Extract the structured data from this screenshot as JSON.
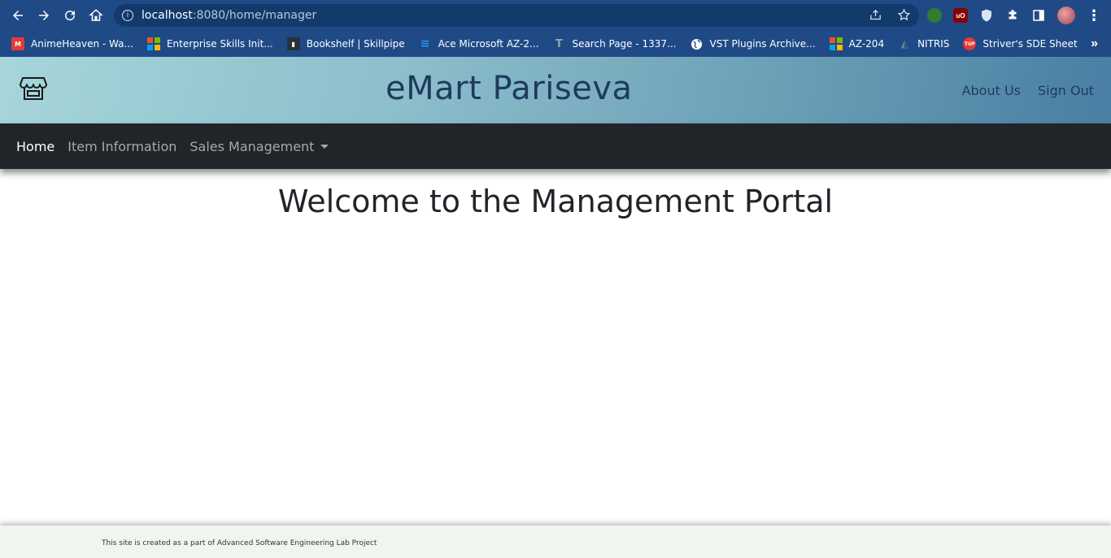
{
  "browser": {
    "url_host": "localhost",
    "url_rest": ":8080/home/manager",
    "bookmarks": [
      {
        "label": "AnimeHeaven - Wa...",
        "icon": "animeheaven-icon",
        "color": "#e53935"
      },
      {
        "label": "Enterprise Skills Init...",
        "icon": "microsoft-icon",
        "color": "#f25022"
      },
      {
        "label": "Bookshelf | Skillpipe",
        "icon": "skillpipe-icon",
        "color": "#263238"
      },
      {
        "label": "Ace Microsoft AZ-2...",
        "icon": "ace-icon",
        "color": "#2196f3"
      },
      {
        "label": "Search Page - 1337...",
        "icon": "1337x-icon",
        "color": "#546e7a"
      },
      {
        "label": "VST Plugins Archive...",
        "icon": "globe-icon",
        "color": "#ffffff"
      },
      {
        "label": "AZ-204",
        "icon": "microsoft-icon",
        "color": "#f25022"
      },
      {
        "label": "NITRIS",
        "icon": "nitris-icon",
        "color": "#90a4ae"
      },
      {
        "label": "Striver's SDE Sheet",
        "icon": "tuf-icon",
        "color": "#e53935"
      }
    ]
  },
  "app": {
    "brand": "eMart Pariseva",
    "header_links": {
      "about": "About Us",
      "signout": "Sign Out"
    },
    "nav": {
      "home": "Home",
      "item_info": "Item Information",
      "sales": "Sales Management"
    },
    "welcome": "Welcome to the Management Portal",
    "footer": "This site is created as a part of Advanced Software Engineering Lab Project"
  }
}
